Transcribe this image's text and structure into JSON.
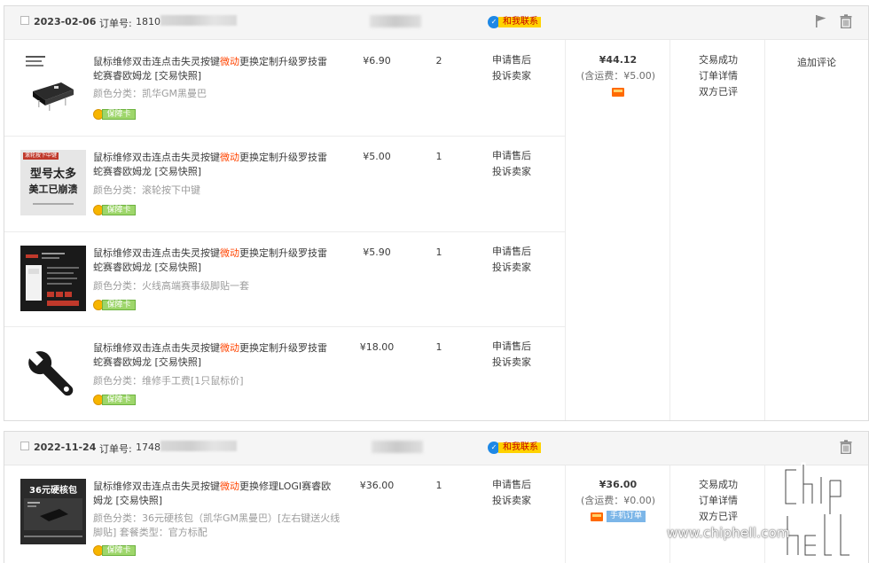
{
  "orders": [
    {
      "date": "2023-02-06",
      "order_no_label": "订单号:",
      "order_no_value": "1810",
      "contact_label": "和我联系",
      "total": "¥44.12",
      "shipping": "(含运费：¥5.00)",
      "status_lines": [
        "交易成功",
        "订单详情",
        "双方已评"
      ],
      "review_action": "追加评论",
      "items": [
        {
          "title_pre": "鼠标维修双击连点击失灵按键",
          "title_hl": "微动",
          "title_post": "更换定制升级罗技雷蛇赛睿欧姆龙 [交易快照]",
          "sku": "颜色分类：凯华GM黑曼巴",
          "price": "¥6.90",
          "qty": "2",
          "svc1": "申请售后",
          "svc2": "投诉卖家",
          "guarantee": "保障卡",
          "thumb": "micro-switch"
        },
        {
          "title_pre": "鼠标维修双击连点击失灵按键",
          "title_hl": "微动",
          "title_post": "更换定制升级罗技雷蛇赛睿欧姆龙 [交易快照]",
          "sku": "颜色分类：滚轮按下中键",
          "price": "¥5.00",
          "qty": "1",
          "svc1": "申请售后",
          "svc2": "投诉卖家",
          "guarantee": "保障卡",
          "thumb": "poster",
          "thumb_text": [
            "滚轮按下中键",
            "型号太多",
            "美工已崩溃"
          ]
        },
        {
          "title_pre": "鼠标维修双击连点击失灵按键",
          "title_hl": "微动",
          "title_post": "更换定制升级罗技雷蛇赛睿欧姆龙 [交易快照]",
          "sku": "颜色分类：火线高端赛事级脚贴一套",
          "price": "¥5.90",
          "qty": "1",
          "svc1": "申请售后",
          "svc2": "投诉卖家",
          "guarantee": "保障卡",
          "thumb": "feet-pads"
        },
        {
          "title_pre": "鼠标维修双击连点击失灵按键",
          "title_hl": "微动",
          "title_post": "更换定制升级罗技雷蛇赛睿欧姆龙 [交易快照]",
          "sku": "颜色分类：维修手工费[1只鼠标价]",
          "price": "¥18.00",
          "qty": "1",
          "svc1": "申请售后",
          "svc2": "投诉卖家",
          "guarantee": "保障卡",
          "thumb": "wrench"
        }
      ]
    },
    {
      "date": "2022-11-24",
      "order_no_label": "订单号:",
      "order_no_value": "1748",
      "contact_label": "和我联系",
      "total": "¥36.00",
      "shipping": "(含运费：¥0.00)",
      "mobile_badge": "手机订单",
      "status_lines": [
        "交易成功",
        "订单详情",
        "双方已评"
      ],
      "items": [
        {
          "title_pre": "鼠标维修双击连点击失灵按键",
          "title_hl": "微动",
          "title_post": "更换修理LOGI赛睿欧姆龙 [交易快照]",
          "sku": "颜色分类：36元硬核包（凯华GM黑曼巴）[左右键送火线脚贴] 套餐类型：官方标配",
          "price": "¥36.00",
          "qty": "1",
          "svc1": "申请售后",
          "svc2": "投诉卖家",
          "guarantee": "保障卡",
          "thumb": "hardcore-pack",
          "thumb_text": "36元硬核包"
        }
      ]
    }
  ],
  "watermark": {
    "url": "www.chiphell.com",
    "logo": "chip hell"
  },
  "colors": {
    "highlight": "#ff4400",
    "guarantee_green": "#9ed66b",
    "contact_yellow": "#ffd200"
  }
}
